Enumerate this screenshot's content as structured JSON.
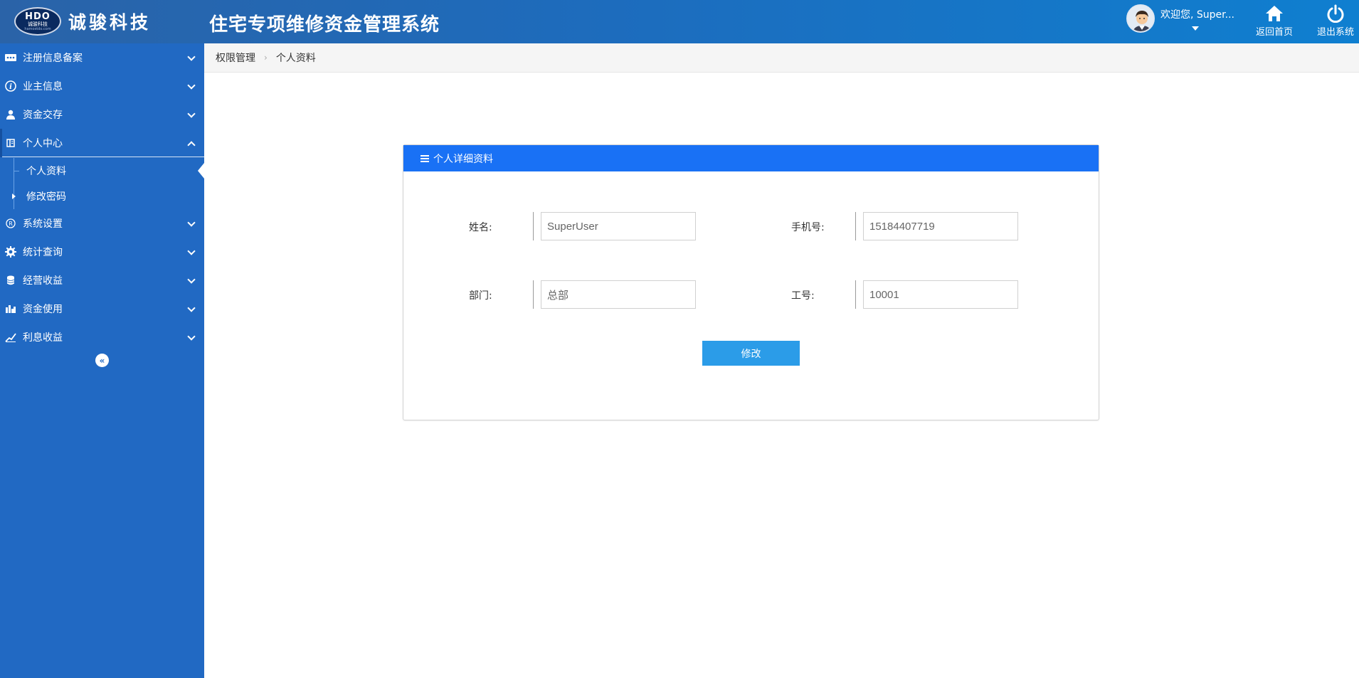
{
  "header": {
    "logo": {
      "mark": "HDO",
      "mark_cn": "诚骏科技",
      "mark_url": "hamostdo.com",
      "name": "诚骏科技"
    },
    "title": "住宅专项维修资金管理系统",
    "user": {
      "welcome": "欢迎您, Super..."
    },
    "actions": [
      {
        "label": "返回首页",
        "icon": "home-icon"
      },
      {
        "label": "退出系统",
        "icon": "power-icon"
      }
    ]
  },
  "sidebar": {
    "items": [
      {
        "label": "注册信息备案",
        "icon": "dots-icon",
        "expanded": false
      },
      {
        "label": "业主信息",
        "icon": "info-icon",
        "expanded": false
      },
      {
        "label": "资金交存",
        "icon": "user-icon",
        "expanded": false
      },
      {
        "label": "个人中心",
        "icon": "book-icon",
        "expanded": true,
        "children": [
          {
            "label": "个人资料",
            "active": true
          },
          {
            "label": "修改密码",
            "active": false
          }
        ]
      },
      {
        "label": "系统设置",
        "icon": "registered-icon",
        "expanded": false
      },
      {
        "label": "统计查询",
        "icon": "gear-icon",
        "expanded": false
      },
      {
        "label": "经营收益",
        "icon": "database-icon",
        "expanded": false
      },
      {
        "label": "资金使用",
        "icon": "bar-chart-icon",
        "expanded": false
      },
      {
        "label": "利息收益",
        "icon": "trend-icon",
        "expanded": false
      }
    ],
    "collapse_glyph": "«"
  },
  "breadcrumb": [
    "权限管理",
    "个人资料"
  ],
  "breadcrumb_sep": "›",
  "card": {
    "title": "个人详细资料",
    "fields": {
      "name": {
        "label": "姓名:",
        "value": "SuperUser"
      },
      "phone": {
        "label": "手机号:",
        "value": "15184407719"
      },
      "dept": {
        "label": "部门:",
        "value": "总部"
      },
      "emp_no": {
        "label": "工号:",
        "value": "10001"
      }
    },
    "submit_label": "修改"
  },
  "colors": {
    "header_gradient_start": "#2a63a8",
    "header_gradient_end": "#0f7fd0",
    "sidebar_bg": "#2169c3",
    "card_header": "#1971f5",
    "button": "#2b9ce8"
  }
}
